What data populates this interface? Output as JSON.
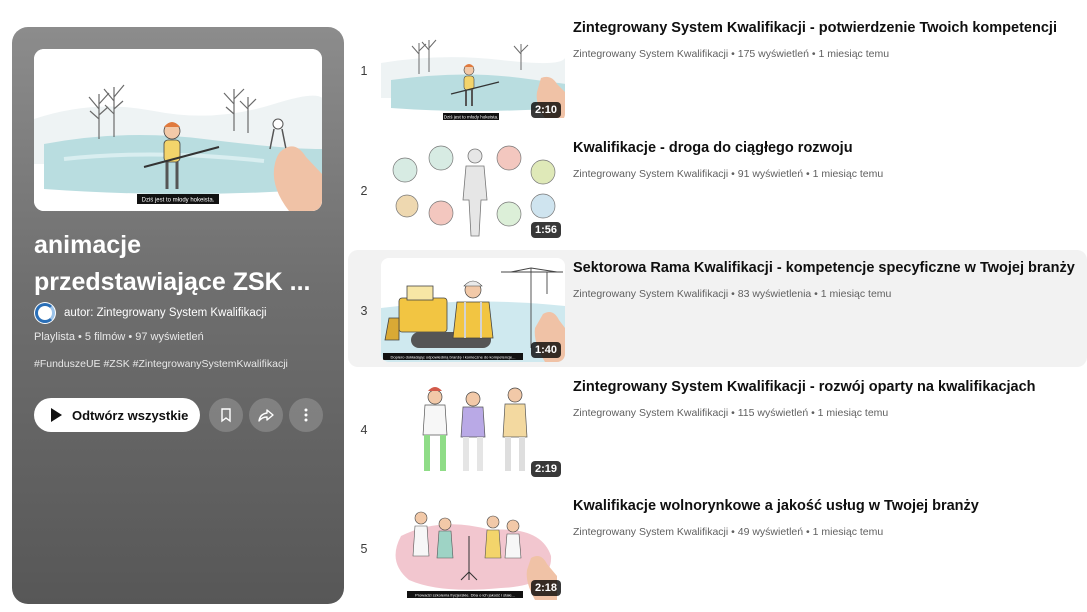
{
  "playlist": {
    "title": "animacje przedstawiające ZSK ...",
    "owner": "autor: Zintegrowany System Kwalifikacji",
    "meta": "Playlista • 5 filmów • 97 wyświetleń",
    "tags": "#FunduszeUE #ZSK #ZintegrowanySystemKwalifikacji",
    "play_all_label": "Odtwórz wszystkie",
    "thumb_caption": "Dziś jest to młody hokeista."
  },
  "videos": [
    {
      "index": "1",
      "title": "Zintegrowany System Kwalifikacji - potwierdzenie Twoich kompetencji",
      "meta": "Zintegrowany System Kwalifikacji • 175 wyświetleń • 1 miesiąc temu",
      "duration": "2:10",
      "caption": "Dziś jest to młody hokeista."
    },
    {
      "index": "2",
      "title": "Kwalifikacje - droga do ciągłego rozwoju",
      "meta": "Zintegrowany System Kwalifikacji • 91 wyświetleń • 1 miesiąc temu",
      "duration": "1:56",
      "caption": ""
    },
    {
      "index": "3",
      "title": "Sektorowa Rama Kwalifikacji - kompetencje specyficzne w Twojej branży",
      "meta": "Zintegrowany System Kwalifikacji • 83 wyświetlenia • 1 miesiąc temu",
      "duration": "1:40",
      "caption": "Dopiero dokładając odpowiednią branżę i konieczne do kompetencje...",
      "active": true
    },
    {
      "index": "4",
      "title": "Zintegrowany System Kwalifikacji - rozwój oparty na kwalifikacjach",
      "meta": "Zintegrowany System Kwalifikacji • 115 wyświetleń • 1 miesiąc temu",
      "duration": "2:19",
      "caption": ""
    },
    {
      "index": "5",
      "title": "Kwalifikacje wolnorynkowe a jakość usług w Twojej branży",
      "meta": "Zintegrowany System Kwalifikacji • 49 wyświetleń • 1 miesiąc temu",
      "duration": "2:18",
      "caption": "Prowadzi szkolenia fryzjerskie. Dba o ich jakość i stałe..."
    }
  ],
  "colors": {
    "panel_top": "#8c8c8c",
    "panel_bottom": "#575757",
    "active_row": "#f2f2f2",
    "meta_text": "#606060"
  },
  "icons": {
    "play": "play-icon",
    "save": "bookmark-icon",
    "share": "share-icon",
    "more": "more-vert-icon"
  }
}
